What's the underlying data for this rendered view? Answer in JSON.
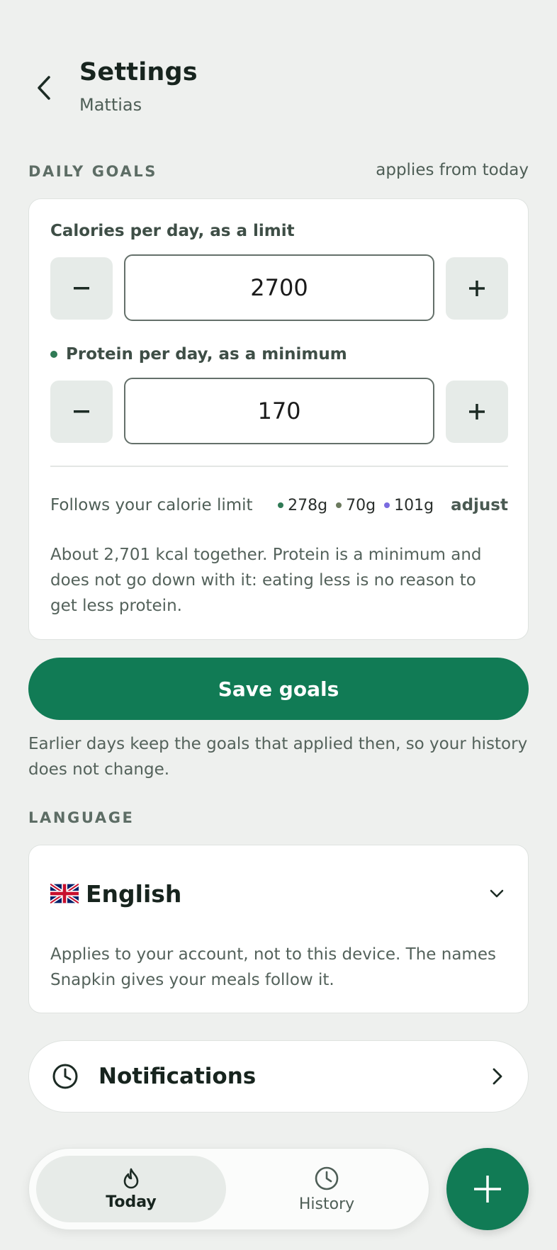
{
  "header": {
    "title": "Settings",
    "subtitle": "Mattias"
  },
  "daily_goals": {
    "section_label": "DAILY GOALS",
    "note": "applies from today",
    "calories": {
      "label": "Calories per day, as a limit",
      "value": "2700",
      "minus": "−",
      "plus": "+"
    },
    "protein": {
      "label": "Protein per day, as a minimum",
      "value": "170",
      "minus": "−",
      "plus": "+",
      "dot_color": "#2f7a55"
    },
    "macros": {
      "label": "Follows your calorie limit",
      "items": [
        {
          "value": "278g",
          "color": "#2f7a55"
        },
        {
          "value": "70g",
          "color": "#6b7a5e"
        },
        {
          "value": "101g",
          "color": "#7a6be0"
        }
      ],
      "adjust_label": "adjust"
    },
    "description": "About 2,701 kcal together. Protein is a minimum and does not go down with it: eating less is no reason to get less protein."
  },
  "save": {
    "label": "Save goals",
    "note": "Earlier days keep the goals that applied then, so your history does not change."
  },
  "language": {
    "section_label": "LANGUAGE",
    "selected": "English",
    "flag": "uk-flag-icon",
    "description": "Applies to your account, not to this device. The names Snapkin gives your meals follow it."
  },
  "notifications": {
    "label": "Notifications"
  },
  "nav": {
    "today": "Today",
    "history": "History"
  },
  "colors": {
    "accent": "#117b55",
    "background": "#eef0ee"
  }
}
